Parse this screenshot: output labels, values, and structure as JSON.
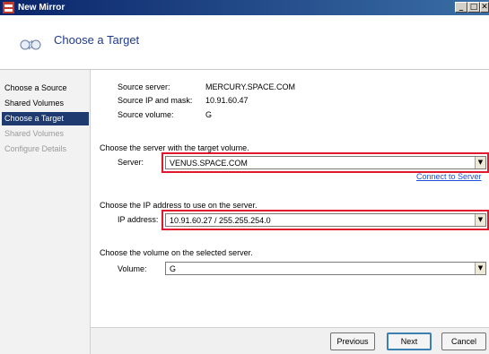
{
  "window": {
    "title": "New Mirror"
  },
  "header": {
    "title": "Choose a Target"
  },
  "sidebar": {
    "items": [
      {
        "label": "Choose a Source",
        "state": "normal"
      },
      {
        "label": "Shared Volumes",
        "state": "normal"
      },
      {
        "label": "Choose a Target",
        "state": "active"
      },
      {
        "label": "Shared Volumes",
        "state": "disabled"
      },
      {
        "label": "Configure Details",
        "state": "disabled"
      }
    ]
  },
  "source": {
    "server_label": "Source server:",
    "server_value": "MERCURY.SPACE.COM",
    "ip_label": "Source IP and mask:",
    "ip_value": "10.91.60.47",
    "volume_label": "Source volume:",
    "volume_value": "G"
  },
  "target_server": {
    "prompt": "Choose the server with the target volume.",
    "label": "Server:",
    "value": "VENUS.SPACE.COM",
    "connect_link": "Connect to Server"
  },
  "target_ip": {
    "prompt": "Choose the IP address to use on the server.",
    "label": "IP address:",
    "value": "10.91.60.27 / 255.255.254.0"
  },
  "target_volume": {
    "prompt": "Choose the volume on the selected server.",
    "label": "Volume:",
    "value": "G"
  },
  "footer": {
    "previous": "Previous",
    "next": "Next",
    "cancel": "Cancel"
  },
  "colors": {
    "highlight": "#e0192e",
    "active_nav": "#1e3a6e",
    "link": "#1b4fd8"
  }
}
